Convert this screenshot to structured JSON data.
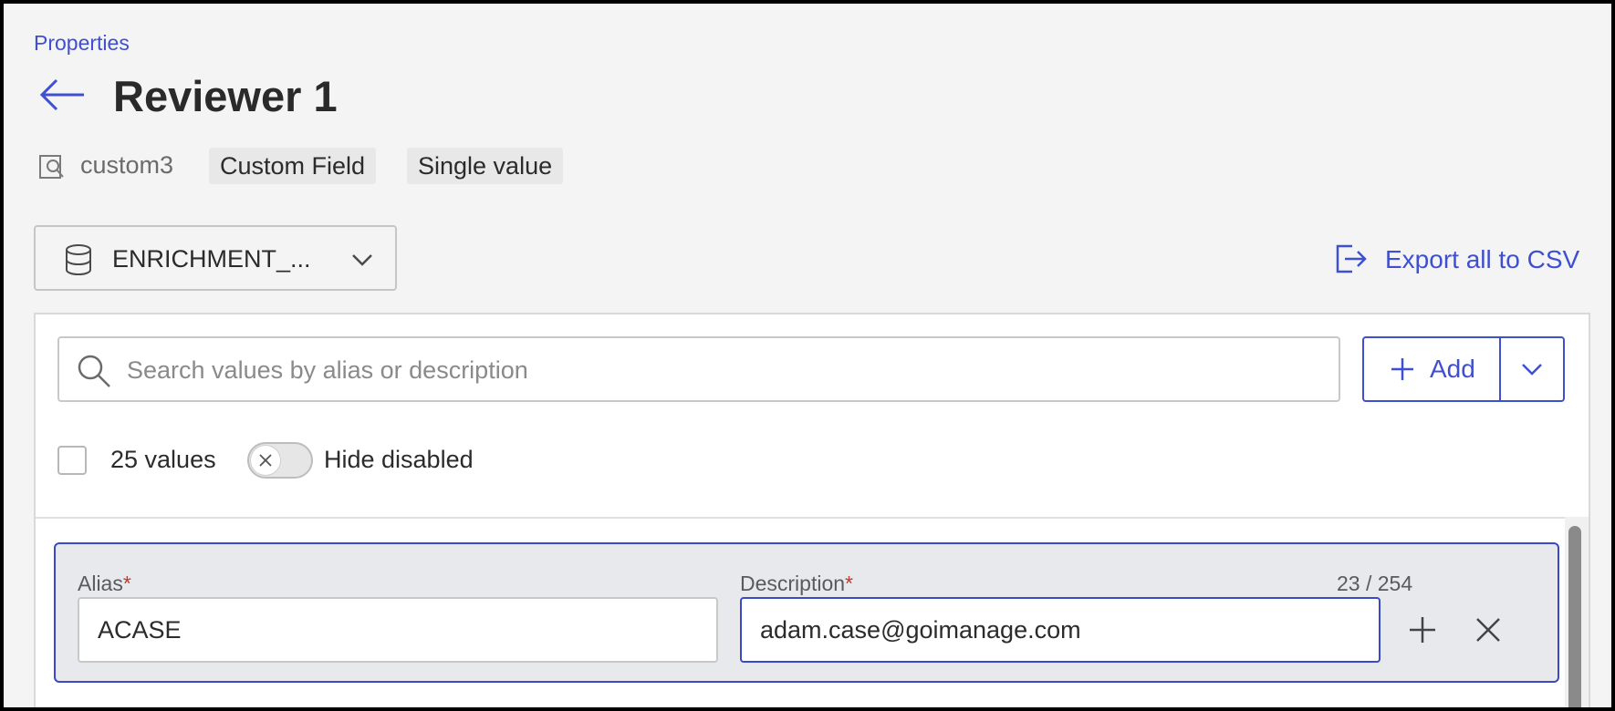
{
  "breadcrumb": {
    "label": "Properties"
  },
  "page": {
    "title": "Reviewer 1"
  },
  "meta": {
    "field_id": "custom3",
    "tags": [
      "Custom Field",
      "Single value"
    ]
  },
  "source": {
    "selected": "ENRICHMENT_..."
  },
  "export": {
    "label": "Export all to CSV"
  },
  "search": {
    "placeholder": "Search values by alias or description",
    "value": ""
  },
  "add": {
    "label": "Add"
  },
  "list": {
    "count_label": "25 values",
    "hide_disabled_label": "Hide disabled",
    "hide_disabled": false
  },
  "row": {
    "alias_label": "Alias",
    "description_label": "Description",
    "required_mark": "*",
    "char_count": "23 / 254",
    "alias_value": "ACASE",
    "description_value": "adam.case@goimanage.com"
  },
  "colors": {
    "accent": "#3f4fd1",
    "required": "#c0392b",
    "background": "#f4f4f4"
  },
  "icons": [
    "arrow-left-icon",
    "search-doc-icon",
    "database-icon",
    "chevron-down-icon",
    "export-icon",
    "search-icon",
    "plus-icon",
    "close-icon"
  ]
}
